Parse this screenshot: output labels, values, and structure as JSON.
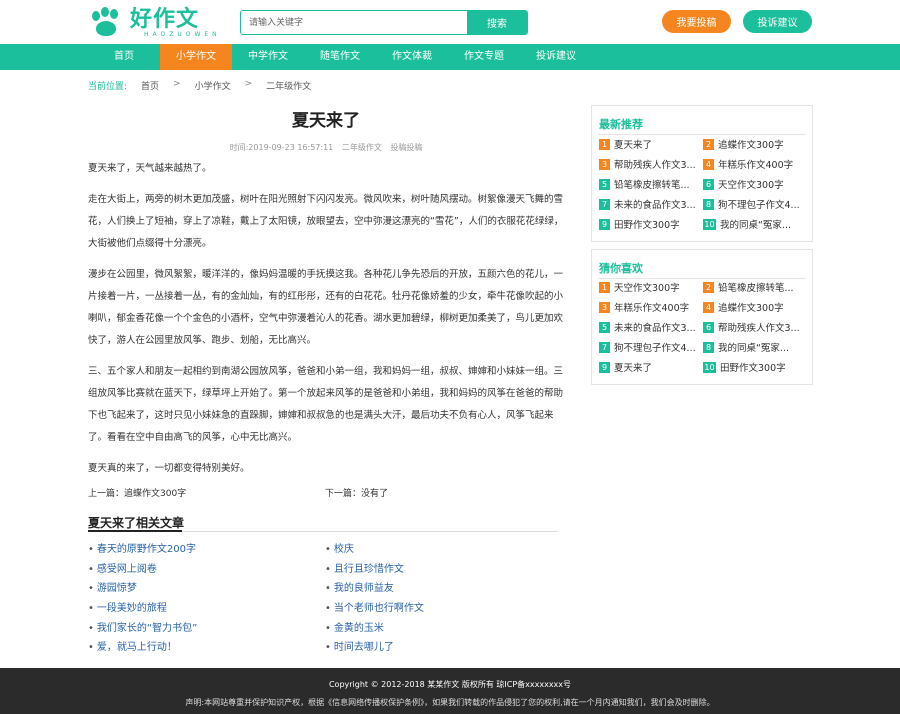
{
  "header": {
    "logo_main": "好作文",
    "logo_sub": "HAOZUOWEN",
    "search_placeholder": "请输入关键字",
    "search_button": "搜索",
    "submit_button": "我要投稿",
    "suggest_button": "投诉建议"
  },
  "nav": [
    "首页",
    "小学作文",
    "中学作文",
    "随笔作文",
    "作文体裁",
    "作文专题",
    "投诉建议"
  ],
  "nav_active": "小学作文",
  "breadcrumb": {
    "label": "当前位置:",
    "items": [
      "首页",
      "小学作文",
      "二年级作文"
    ]
  },
  "article": {
    "title": "夏天来了",
    "time": "时间:2019-09-23 16:57:11",
    "category": "二年级作文",
    "source": "投稿投稿",
    "paragraphs": [
      "夏天来了，天气越来越热了。",
      "走在大街上，两旁的树木更加茂盛，树叶在阳光照射下闪闪发亮。微风吹来，树叶随风摆动。树絮像漫天飞舞的雪花，人们换上了短袖，穿上了凉鞋，戴上了太阳镜，放眼望去，空中弥漫这漂亮的“雪花”，人们的衣服花花绿绿，大街被他们点缀得十分漂亮。",
      "漫步在公园里，微风絮絮，暖洋洋的，像妈妈温暖的手抚摸这我。各种花儿争先恐后的开放，五颜六色的花儿，一片接着一片，一丛接着一丛，有的金灿灿，有的红彤彤，还有的白花花。牡丹花像娇羞的少女，牵牛花像吹起的小喇叭，郁金香花像一个个金色的小酒杯，空气中弥漫着沁人的花香。湖水更加碧绿，柳树更加柔美了，鸟儿更加欢快了，游人在公园里放风筝、跑步、划船，无比高兴。",
      "三、五个家人和朋友一起相约到南湖公园放风筝，爸爸和小弟一组，我和妈妈一组，叔叔、婶婶和小妹妹一组。三组放风筝比赛就在蓝天下，绿草坪上开始了。第一个放起来风筝的是爸爸和小弟组，我和妈妈的风筝在爸爸的帮助下也飞起来了，这时只见小妹妹急的直跺脚，婶婶和叔叔急的也是满头大汗，最后功夫不负有心人，风筝飞起来了。看看在空中自由高飞的风筝，心中无比高兴。",
      "夏天真的来了，一切都变得特别美好。"
    ],
    "prev": "上一篇：追蝶作文300字",
    "next": "下一篇：没有了"
  },
  "related": {
    "title": "夏天来了相关文章",
    "left": [
      "春天的原野作文200字",
      "感受网上阅卷",
      "游园惊梦",
      "一段美妙的旅程",
      "我们家长的“智力书包”",
      "爱，就马上行动！"
    ],
    "right": [
      "校庆",
      "且行且珍惜作文",
      "我的良师益友",
      "当个老师也行啊作文",
      "金黄的玉米",
      "时间去哪儿了"
    ]
  },
  "sidebar": {
    "latest": {
      "title": "最新推荐",
      "items": [
        "夏天来了",
        "追蝶作文300字",
        "帮助残疾人作文3...",
        "年糕乐作文400字",
        "铅笔橡皮擦转笔...",
        "天空作文300字",
        "未来的食品作文3...",
        "狗不理包子作文4...",
        "田野作文300字",
        "我的同桌“冤家..."
      ]
    },
    "guess": {
      "title": "猜你喜欢",
      "items": [
        "天空作文300字",
        "铅笔橡皮擦转笔...",
        "年糕乐作文400字",
        "追蝶作文300字",
        "未来的食品作文3...",
        "帮助残疾人作文3...",
        "狗不理包子作文4...",
        "我的同桌“冤家...",
        "夏天来了",
        "田野作文300字"
      ]
    }
  },
  "footer": {
    "copyright": "Copyright © 2012-2018 某某作文 版权所有 琼ICP备xxxxxxxx号",
    "notice": "声明:本网站尊重并保护知识产权，根据《信息网络传播权保护条例》，如果我们转载的作品侵犯了您的权利,请在一个月内通知我们，我们会及时删除。"
  },
  "colors": {
    "brand": "#1cbf9b",
    "accent": "#f5851f",
    "footer_bg": "#2b2b2b"
  }
}
